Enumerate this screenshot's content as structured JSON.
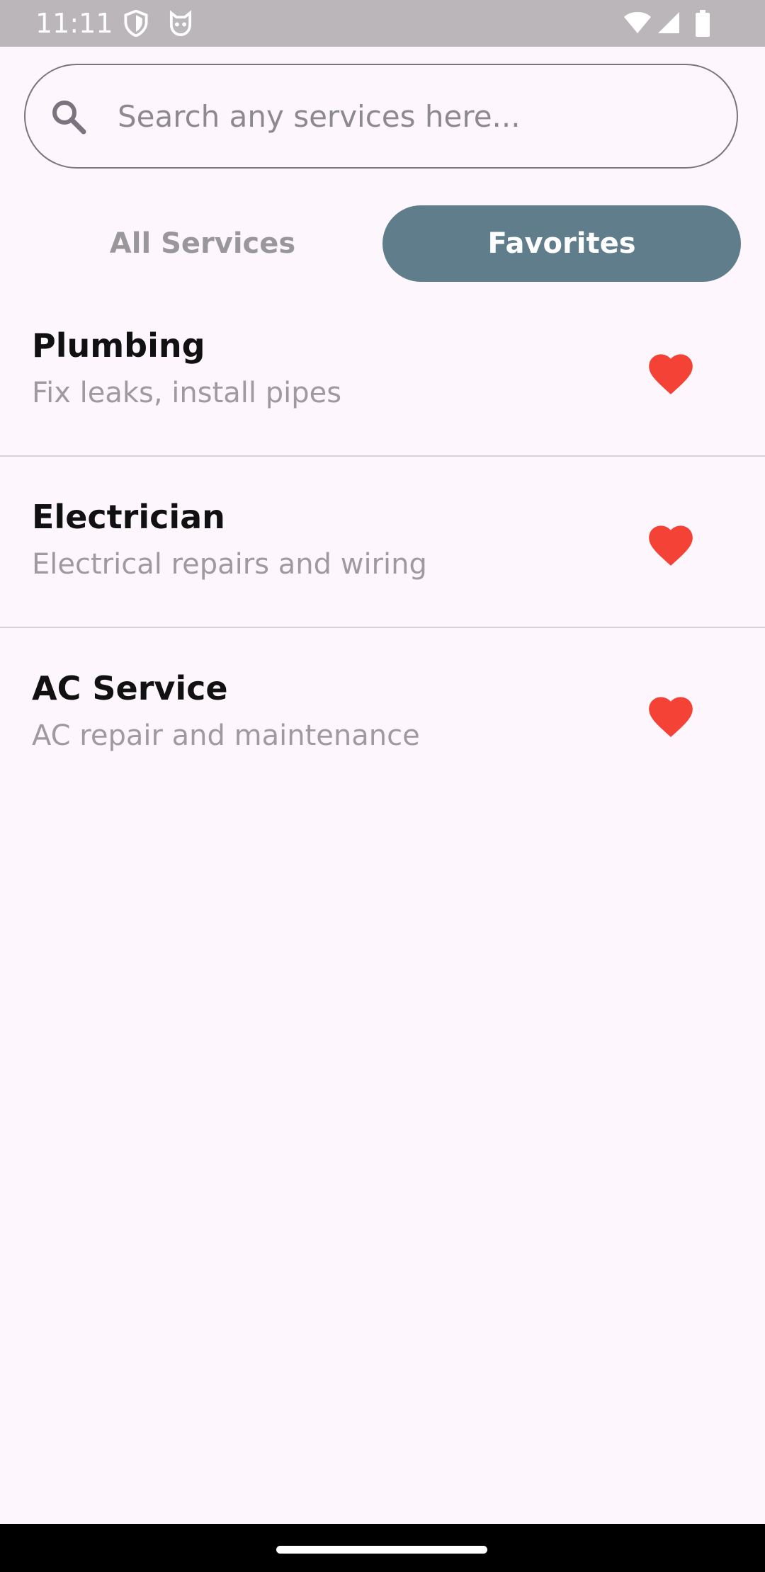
{
  "status_bar": {
    "time": "11:11",
    "icons": [
      "shield-icon",
      "cat-icon",
      "wifi-icon",
      "signal-icon",
      "battery-icon"
    ]
  },
  "search": {
    "placeholder": "Search any services here...",
    "value": "",
    "icon": "search-icon"
  },
  "tabs": {
    "all_label": "All Services",
    "favorites_label": "Favorites",
    "active": "Favorites"
  },
  "services": [
    {
      "title": "Plumbing",
      "subtitle": "Fix leaks, install pipes",
      "favorite": true
    },
    {
      "title": "Electrician",
      "subtitle": "Electrical repairs and wiring",
      "favorite": true
    },
    {
      "title": "AC Service",
      "subtitle": "AC repair and maintenance",
      "favorite": true
    }
  ],
  "colors": {
    "background": "#fdf7fd",
    "active_tab": "#607d8b",
    "heart": "#f44336",
    "status_bar": "#bab6ba"
  }
}
